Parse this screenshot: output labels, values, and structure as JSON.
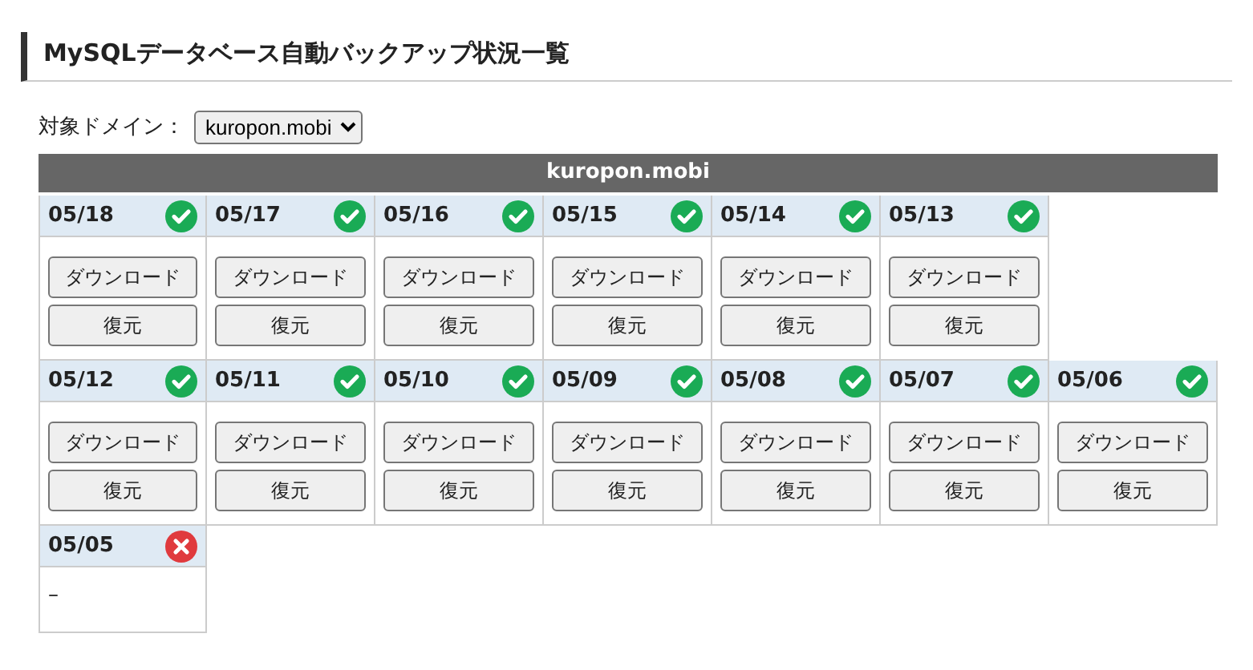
{
  "heading": "MySQLデータベース自動バックアップ状況一覧",
  "domain_select": {
    "label": "対象ドメイン：",
    "value": "kuropon.mobi"
  },
  "table": {
    "title": "kuropon.mobi",
    "rows": [
      [
        {
          "date": "05/18",
          "succeeded": true,
          "actions": [
            "ダウンロード",
            "復元"
          ]
        },
        {
          "date": "05/17",
          "succeeded": true,
          "actions": [
            "ダウンロード",
            "復元"
          ]
        },
        {
          "date": "05/16",
          "succeeded": true,
          "actions": [
            "ダウンロード",
            "復元"
          ]
        },
        {
          "date": "05/15",
          "succeeded": true,
          "actions": [
            "ダウンロード",
            "復元"
          ]
        },
        {
          "date": "05/14",
          "succeeded": true,
          "actions": [
            "ダウンロード",
            "復元"
          ]
        },
        {
          "date": "05/13",
          "succeeded": true,
          "actions": [
            "ダウンロード",
            "復元"
          ]
        }
      ],
      [
        {
          "date": "05/12",
          "succeeded": true,
          "actions": [
            "ダウンロード",
            "復元"
          ]
        },
        {
          "date": "05/11",
          "succeeded": true,
          "actions": [
            "ダウンロード",
            "復元"
          ]
        },
        {
          "date": "05/10",
          "succeeded": true,
          "actions": [
            "ダウンロード",
            "復元"
          ]
        },
        {
          "date": "05/09",
          "succeeded": true,
          "actions": [
            "ダウンロード",
            "復元"
          ]
        },
        {
          "date": "05/08",
          "succeeded": true,
          "actions": [
            "ダウンロード",
            "復元"
          ]
        },
        {
          "date": "05/07",
          "succeeded": true,
          "actions": [
            "ダウンロード",
            "復元"
          ]
        },
        {
          "date": "05/06",
          "succeeded": true,
          "actions": [
            "ダウンロード",
            "復元"
          ]
        }
      ],
      [
        {
          "date": "05/05",
          "succeeded": false,
          "note": "–"
        }
      ]
    ]
  }
}
